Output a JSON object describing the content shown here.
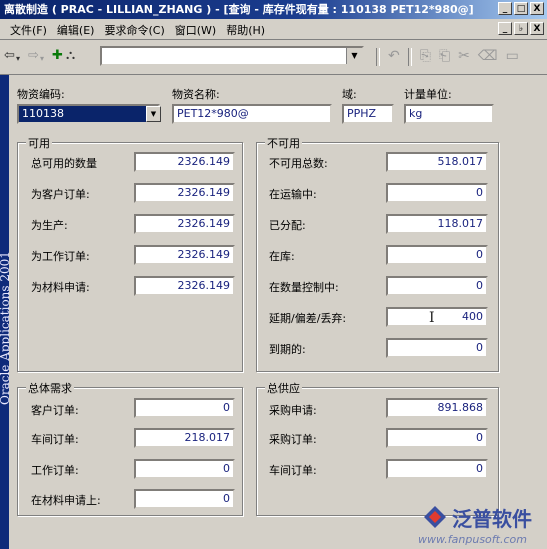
{
  "window": {
    "title": "离散制造 ( PRAC - LILLIAN_ZHANG ) - [查询 - 库存件现有量 : 110138  PET12*980@]"
  },
  "window_buttons": [
    "_",
    "□",
    "X"
  ],
  "menu": {
    "items": [
      "文件(F)",
      "编辑(E)",
      "要求命令(C)",
      "窗口(W)",
      "帮助(H)"
    ],
    "mdi_buttons": [
      "_",
      "♭",
      "X"
    ]
  },
  "toolbar": {
    "search_value": ""
  },
  "sidebar": {
    "text": "Oracle Applications 2001"
  },
  "header": {
    "item_code_label": "物资编码:",
    "item_code": "110138",
    "item_name_label": "物资名称:",
    "item_name": "PET12*980@",
    "domain_label": "域:",
    "domain": "PPHZ",
    "uom_label": "计量单位:",
    "uom": "kg"
  },
  "available": {
    "title": "可用",
    "rows": [
      {
        "label": "总可用的数量",
        "value": "2326.149"
      },
      {
        "label": "为客户订单:",
        "value": "2326.149"
      },
      {
        "label": "为生产:",
        "value": "2326.149"
      },
      {
        "label": "为工作订单:",
        "value": "2326.149"
      },
      {
        "label": "为材料申请:",
        "value": "2326.149"
      }
    ]
  },
  "unavailable": {
    "title": "不可用",
    "rows": [
      {
        "label": "不可用总数:",
        "value": "518.017"
      },
      {
        "label": "在运输中:",
        "value": "0"
      },
      {
        "label": "已分配:",
        "value": "118.017"
      },
      {
        "label": "在库:",
        "value": "0"
      },
      {
        "label": "在数量控制中:",
        "value": "0"
      },
      {
        "label": "延期/偏差/丢弃:",
        "value": "400"
      },
      {
        "label": "到期的:",
        "value": "0"
      }
    ]
  },
  "demand": {
    "title": "总体需求",
    "rows": [
      {
        "label": "客户订单:",
        "value": "0"
      },
      {
        "label": "车间订单:",
        "value": "218.017"
      },
      {
        "label": "工作订单:",
        "value": "0"
      },
      {
        "label": "在材料申请上:",
        "value": "0"
      }
    ]
  },
  "supply": {
    "title": "总供应",
    "rows": [
      {
        "label": "采购申请:",
        "value": "891.868"
      },
      {
        "label": "采购订单:",
        "value": "0"
      },
      {
        "label": "车间订单:",
        "value": "0"
      }
    ]
  },
  "watermark": {
    "name": "泛普软件",
    "url": "www.fanpusoft.com"
  }
}
